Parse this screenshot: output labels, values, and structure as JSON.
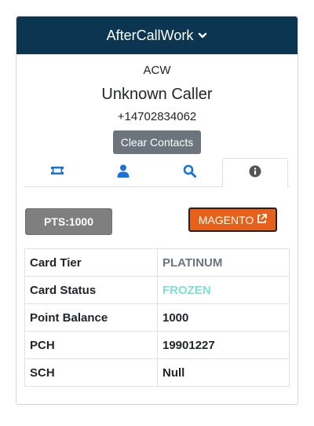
{
  "header": {
    "title": "AfterCallWork"
  },
  "contact": {
    "status": "ACW",
    "name": "Unknown Caller",
    "phone": "+14702834062"
  },
  "buttons": {
    "clear_contacts": "Clear Contacts",
    "points": "PTS:1000",
    "magento": "MAGENTO"
  },
  "tabs": [
    {
      "icon": "ticket-icon",
      "active": false
    },
    {
      "icon": "user-icon",
      "active": false
    },
    {
      "icon": "search-icon",
      "active": false
    },
    {
      "icon": "info-icon",
      "active": true
    }
  ],
  "details": [
    {
      "label": "Card Tier",
      "value": "PLATINUM"
    },
    {
      "label": "Card Status",
      "value": "FROZEN"
    },
    {
      "label": "Point Balance",
      "value": "1000"
    },
    {
      "label": "PCH",
      "value": "19901227"
    },
    {
      "label": "SCH",
      "value": "Null"
    }
  ],
  "colors": {
    "header_bg": "#0b3550",
    "tab_icon": "#1a73d9",
    "active_tab_icon": "#555555",
    "magento": "#e8611a",
    "frozen": "#7fdfd3"
  }
}
